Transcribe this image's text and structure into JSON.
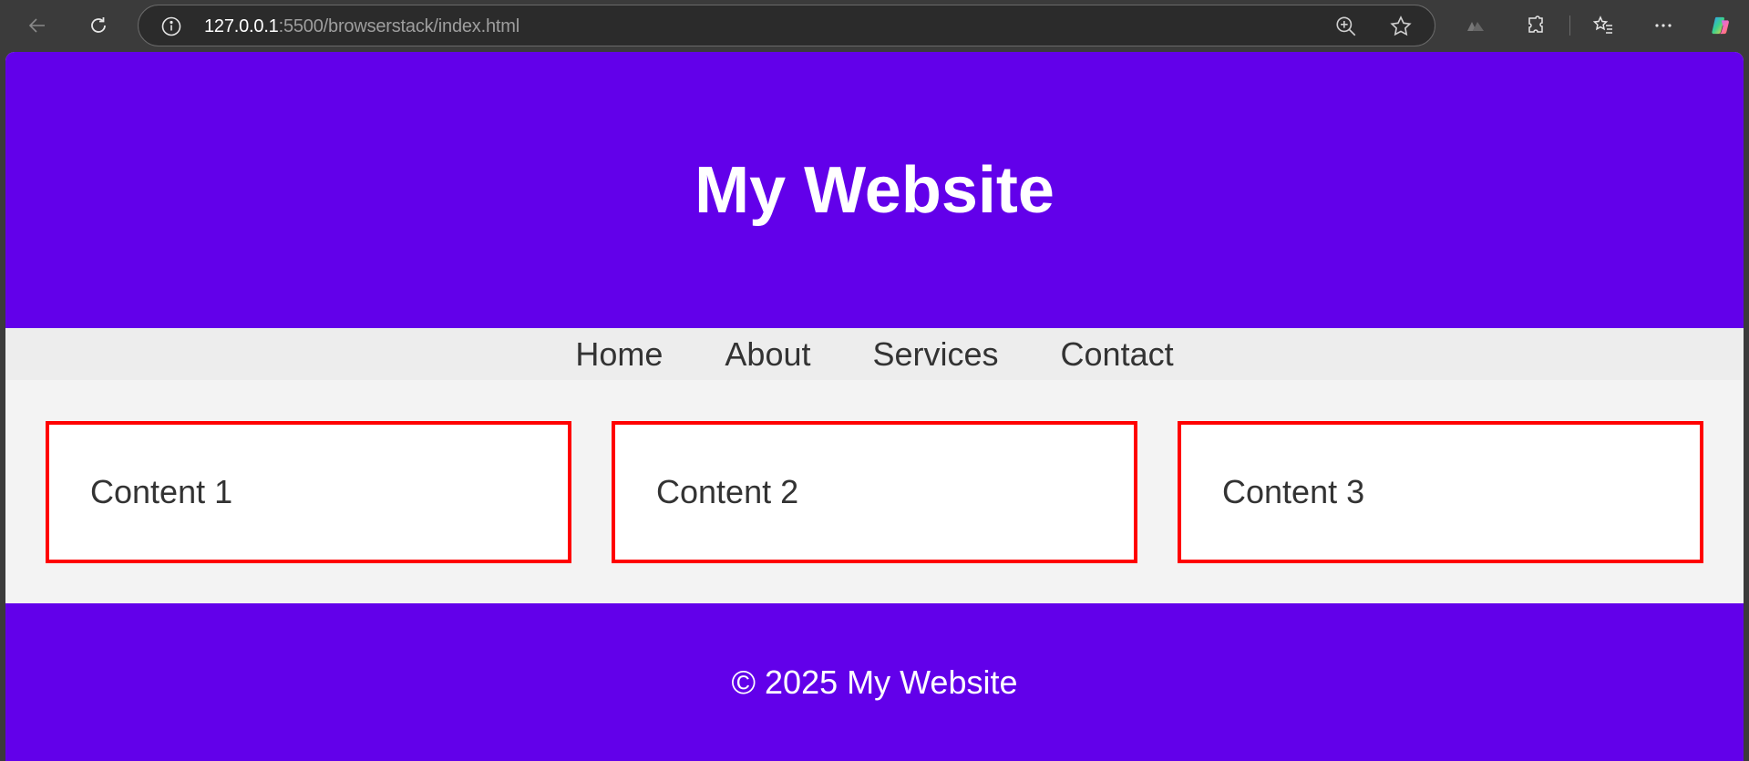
{
  "browser": {
    "url_host": "127.0.0.1",
    "url_rest": ":5500/browserstack/index.html",
    "icons": {
      "back": "back-arrow-icon",
      "reload": "reload-icon",
      "site_info": "info-icon",
      "zoom": "zoom-in-icon",
      "favorite": "star-icon",
      "extension_m": "extension-logo-icon",
      "extensions": "puzzle-icon",
      "favorites": "favorites-icon",
      "more": "more-icon",
      "copilot": "copilot-icon"
    }
  },
  "site": {
    "title": "My Website",
    "nav": [
      {
        "label": "Home"
      },
      {
        "label": "About"
      },
      {
        "label": "Services"
      },
      {
        "label": "Contact"
      }
    ],
    "content": [
      {
        "label": "Content 1"
      },
      {
        "label": "Content 2"
      },
      {
        "label": "Content 3"
      }
    ],
    "footer": "© 2025 My Website",
    "colors": {
      "primary": "#6200ea",
      "nav_bg": "#ededed",
      "main_bg": "#f3f3f3",
      "box_border": "#ff0000",
      "text": "#333333"
    }
  }
}
